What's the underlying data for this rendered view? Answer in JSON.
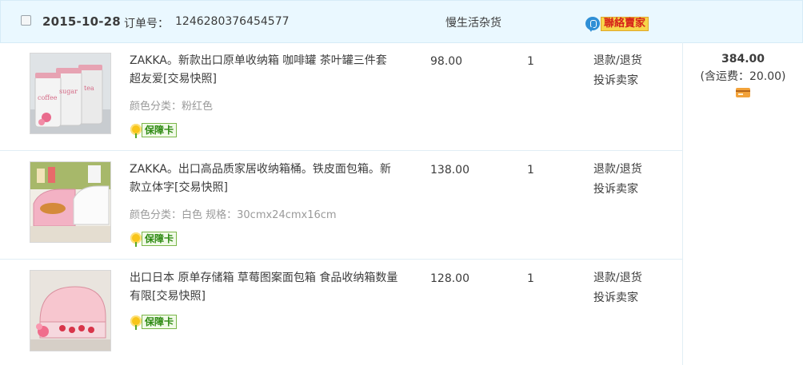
{
  "order": {
    "date": "2015-10-28",
    "order_no_label": "订单号：",
    "order_no": "1246280376454577",
    "shop_name": "慢生活杂货",
    "contact_label": "聯絡賣家",
    "total_amount": "384.00",
    "shipping_note": "(含运费：20.00)",
    "guarantee_label": "保障卡",
    "refund_label": "退款/退货",
    "complain_label": "投诉卖家",
    "items": [
      {
        "title": "ZAKKA。新款出口原单收纳箱 咖啡罐 茶叶罐三件套 超友爱[交易快照]",
        "sku": "颜色分类：粉红色",
        "price": "98.00",
        "qty": "1",
        "canister_labels": [
          "coffee",
          "sugar",
          "tea"
        ]
      },
      {
        "title": "ZAKKA。出口高品质家居收纳箱桶。铁皮面包箱。新款立体字[交易快照]",
        "sku": "颜色分类：白色  规格：30cmx24cmx16cm",
        "price": "138.00",
        "qty": "1"
      },
      {
        "title": "出口日本 原单存储箱 草莓图案面包箱 食品收纳箱数量有限[交易快照]",
        "sku": "",
        "price": "128.00",
        "qty": "1"
      }
    ]
  },
  "colors": {
    "header_bg": "#eaf8ff",
    "divider": "#e1eef5",
    "contact_bg": "#f7d54a",
    "contact_text": "#d6221a",
    "guarantee_text": "#2e8a12"
  }
}
